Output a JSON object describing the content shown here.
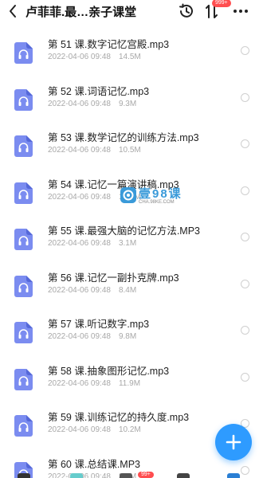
{
  "header": {
    "title": "卢菲菲.最…亲子课堂",
    "sort_badge": "999+",
    "icons": {
      "back": "chevron-left-icon",
      "history": "clock-icon",
      "sort": "sort-icon",
      "more": "more-dots-icon"
    }
  },
  "files": [
    {
      "name": "第 51 课.数字记忆宫殿.mp3",
      "date": "2022-04-06 09:48",
      "size": "14.5M"
    },
    {
      "name": "第 52 课.词语记忆.mp3",
      "date": "2022-04-06 09:48",
      "size": "9.3M"
    },
    {
      "name": "第 53 课.数学记忆的训练方法.mp3",
      "date": "2022-04-06 09:48",
      "size": "10.5M"
    },
    {
      "name": "第 54 课.记忆一篇演讲稿.mp3",
      "date": "2022-04-06 09:48",
      "size": "10.1M"
    },
    {
      "name": "第 55 课.最强大脑的记忆方法.MP3",
      "date": "2022-04-06 09:48",
      "size": "3.1M"
    },
    {
      "name": "第 56 课.记忆一副扑克牌.mp3",
      "date": "2022-04-06 09:48",
      "size": "8.4M"
    },
    {
      "name": "第 57 课.听记数字.mp3",
      "date": "2022-04-06 09:48",
      "size": "9.8M"
    },
    {
      "name": "第 58 课.抽象图形记忆.mp3",
      "date": "2022-04-06 09:48",
      "size": "11.9M"
    },
    {
      "name": "第 59 课.训练记忆的持久度.mp3",
      "date": "2022-04-06 09:48",
      "size": "10.2M"
    },
    {
      "name": "第 60 课.总结课.MP3",
      "date": "2022-04-06 09:48",
      "size": "3.7M"
    }
  ],
  "watermark": {
    "text": "壹98课",
    "sub": "CHA.98KE.COM"
  },
  "bottom_badge": "99+",
  "colors": {
    "file_icon": "#7b8cf0",
    "fab": "#2e9bff",
    "badge": "#ff4d4f"
  }
}
